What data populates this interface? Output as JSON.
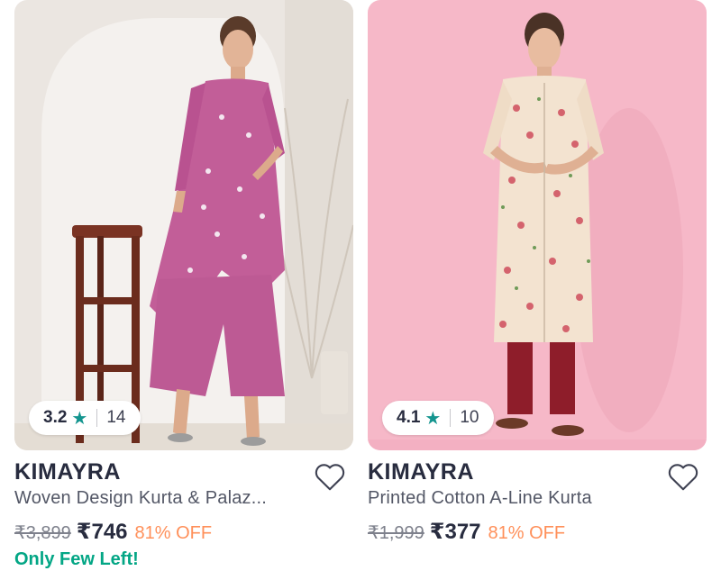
{
  "products": [
    {
      "brand": "KIMAYRA",
      "title": "Woven Design Kurta & Palaz...",
      "rating": "3.2",
      "rating_count": "14",
      "mrp": "₹3,899",
      "price": "₹746",
      "discount": "81% OFF",
      "stock_note": "Only Few Left!"
    },
    {
      "brand": "KIMAYRA",
      "title": "Printed Cotton A-Line Kurta",
      "rating": "4.1",
      "rating_count": "10",
      "mrp": "₹1,999",
      "price": "₹377",
      "discount": "81% OFF"
    }
  ],
  "icons": {
    "star": "★",
    "wishlist": "heart-outline-icon"
  },
  "colors": {
    "rating_star": "#14958f",
    "discount": "#ff905a",
    "stock_note": "#03a685",
    "brand": "#282c3f"
  }
}
